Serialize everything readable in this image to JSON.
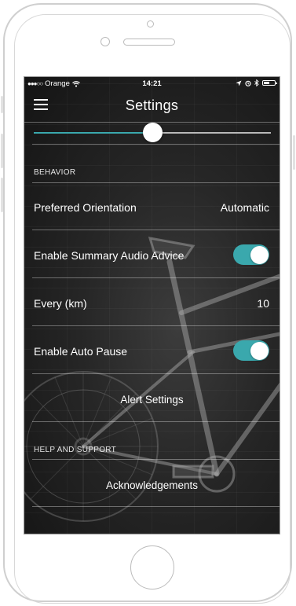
{
  "status_bar": {
    "carrier": "Orange",
    "time": "14:21",
    "icons": [
      "signal-dots-icon",
      "wifi-icon",
      "location-arrow-icon",
      "alarm-icon",
      "bluetooth-icon",
      "battery-icon"
    ]
  },
  "navbar": {
    "title": "Settings",
    "menu_icon": "hamburger-menu-icon"
  },
  "slider": {
    "value": 0.5,
    "fill_color": "#3aa8ad",
    "track_color": "#b9b9b9"
  },
  "behavior": {
    "header": "BEHAVIOR",
    "preferred_orientation": {
      "label": "Preferred Orientation",
      "value": "Automatic"
    },
    "summary_audio": {
      "label": "Enable Summary Audio Advice",
      "enabled": true
    },
    "every": {
      "label": "Every  (km)",
      "value": "10"
    },
    "auto_pause": {
      "label": "Enable Auto Pause",
      "enabled": true
    },
    "alert_settings": {
      "label": "Alert Settings"
    }
  },
  "help": {
    "header": "HELP AND SUPPORT",
    "acknowledgements": {
      "label": "Acknowledgements"
    }
  },
  "colors": {
    "accent": "#3aa8ad",
    "text": "#ffffff"
  }
}
